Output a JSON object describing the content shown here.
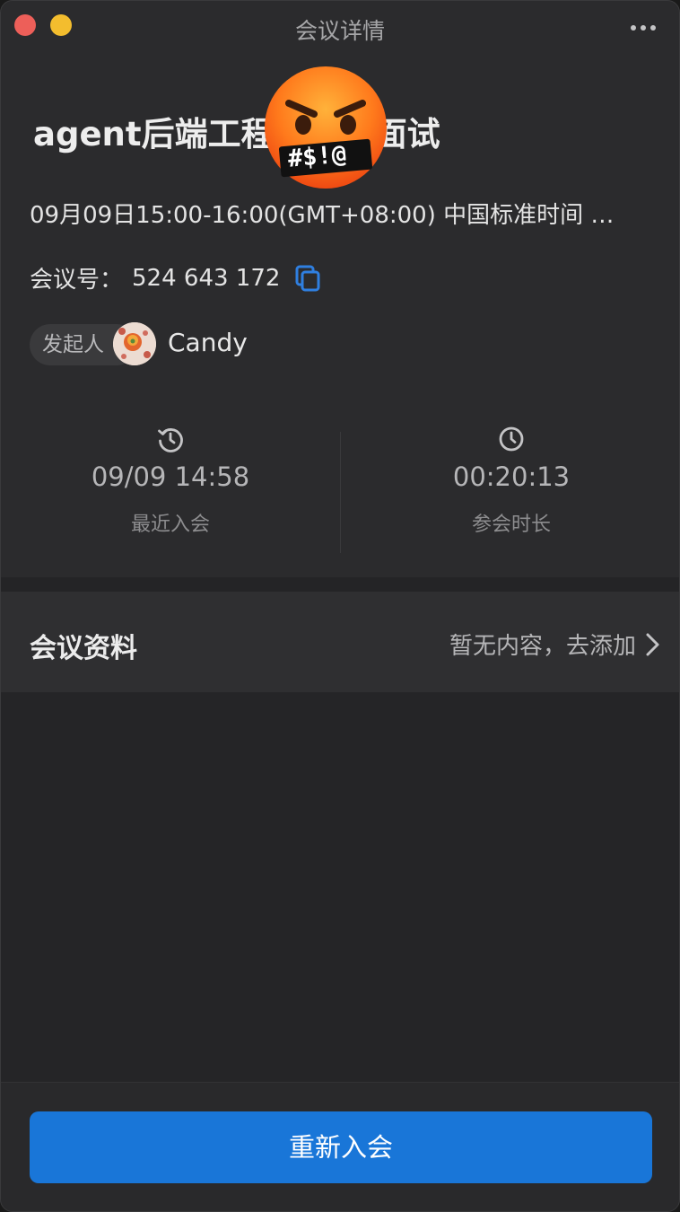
{
  "window": {
    "title": "会议详情",
    "traffic_colors": {
      "close": "#ed5f59",
      "minimize": "#f3bd2e"
    },
    "more_icon": "more-dots-icon"
  },
  "meeting": {
    "title": "agent后端工程师线上面试",
    "datetime": "09月09日15:00-16:00(GMT+08:00) 中国标准时间 …",
    "id_label": "会议号：",
    "id_value": "524 643 172",
    "copy_icon": "copy-icon"
  },
  "host": {
    "label": "发起人",
    "name": "Candy"
  },
  "stats": {
    "last_join": {
      "icon": "history-icon",
      "value": "09/09 14:58",
      "label": "最近入会"
    },
    "duration": {
      "icon": "clock-icon",
      "value": "00:20:13",
      "label": "参会时长"
    }
  },
  "materials": {
    "title": "会议资料",
    "action": "暂无内容，去添加",
    "chevron_icon": "chevron-right-icon"
  },
  "actions": {
    "rejoin": "重新入会",
    "accent": "#1976d8"
  }
}
